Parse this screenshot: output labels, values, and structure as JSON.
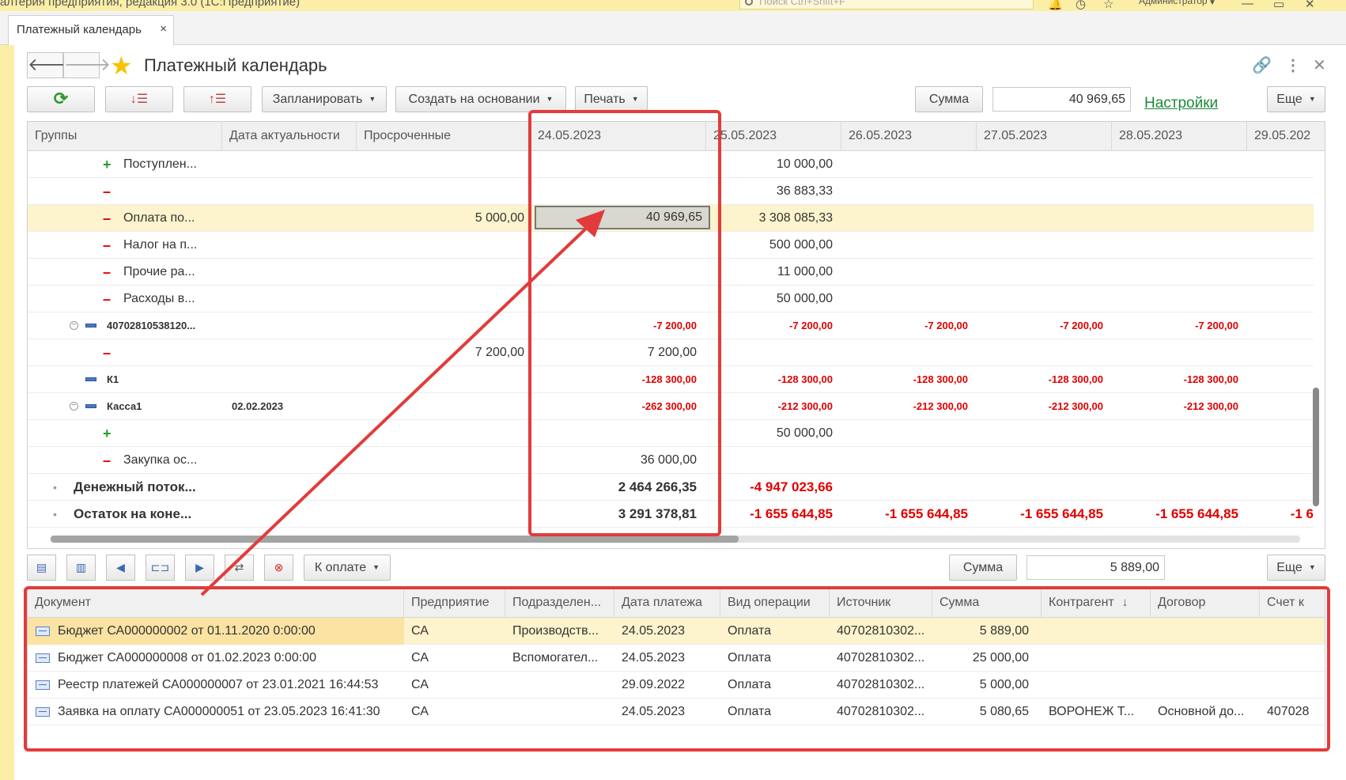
{
  "app": {
    "title": "алтерия предприятия, редакция 3.0  (1С:Предприятие)",
    "search_placeholder": "Поиск Ctrl+Shift+F",
    "user": "Администратор"
  },
  "tab": {
    "label": "Платежный календарь",
    "close": "×"
  },
  "page": {
    "title": "Платежный календарь"
  },
  "toolbar": {
    "plan": "Запланировать",
    "create_based": "Создать на основании",
    "print": "Печать",
    "sum_label": "Сумма",
    "sum_value": "40 969,65",
    "settings": "Настройки",
    "more": "Еще"
  },
  "grid": {
    "headers": [
      "Группы",
      "Дата актуальности",
      "Просроченные",
      "24.05.2023",
      "25.05.2023",
      "26.05.2023",
      "27.05.2023",
      "28.05.2023",
      "29.05.202"
    ],
    "rows": [
      {
        "mark": "+",
        "name": "Поступлен...",
        "actual": "",
        "overdue": "",
        "d24": "",
        "d25": "10 000,00",
        "d26": "",
        "d27": "",
        "d28": "",
        "d29": ""
      },
      {
        "mark": "–",
        "name": "",
        "actual": "",
        "overdue": "",
        "d24": "",
        "d25": "36 883,33",
        "d26": "",
        "d27": "",
        "d28": "",
        "d29": ""
      },
      {
        "mark": "–",
        "name": "Оплата по...",
        "actual": "",
        "overdue": "5 000,00",
        "d24": "40 969,65",
        "d25": "3 308 085,33",
        "d26": "",
        "d27": "",
        "d28": "",
        "d29": ""
      },
      {
        "mark": "–",
        "name": "Налог на п...",
        "actual": "",
        "overdue": "",
        "d24": "",
        "d25": "500 000,00",
        "d26": "",
        "d27": "",
        "d28": "",
        "d29": ""
      },
      {
        "mark": "–",
        "name": "Прочие ра...",
        "actual": "",
        "overdue": "",
        "d24": "",
        "d25": "11 000,00",
        "d26": "",
        "d27": "",
        "d28": "",
        "d29": ""
      },
      {
        "mark": "–",
        "name": "Расходы в...",
        "actual": "",
        "overdue": "",
        "d24": "",
        "d25": "50 000,00",
        "d26": "",
        "d27": "",
        "d28": "",
        "d29": ""
      },
      {
        "mark": "",
        "name": "40702810538120...",
        "actual": "",
        "overdue": "",
        "d24": "-7 200,00",
        "d25": "-7 200,00",
        "d26": "-7 200,00",
        "d27": "-7 200,00",
        "d28": "-7 200,00",
        "d29": ""
      },
      {
        "mark": "–",
        "name": "",
        "actual": "",
        "overdue": "7 200,00",
        "d24": "7 200,00",
        "d25": "",
        "d26": "",
        "d27": "",
        "d28": "",
        "d29": ""
      },
      {
        "mark": "",
        "name": "К1",
        "actual": "",
        "overdue": "",
        "d24": "-128 300,00",
        "d25": "-128 300,00",
        "d26": "-128 300,00",
        "d27": "-128 300,00",
        "d28": "-128 300,00",
        "d29": ""
      },
      {
        "mark": "",
        "name": "Касса1",
        "actual": "02.02.2023",
        "overdue": "",
        "d24": "-262 300,00",
        "d25": "-212 300,00",
        "d26": "-212 300,00",
        "d27": "-212 300,00",
        "d28": "-212 300,00",
        "d29": ""
      },
      {
        "mark": "+",
        "name": "",
        "actual": "",
        "overdue": "",
        "d24": "",
        "d25": "50 000,00",
        "d26": "",
        "d27": "",
        "d28": "",
        "d29": ""
      },
      {
        "mark": "–",
        "name": "Закупка ос...",
        "actual": "",
        "overdue": "",
        "d24": "36 000,00",
        "d25": "",
        "d26": "",
        "d27": "",
        "d28": "",
        "d29": ""
      },
      {
        "mark": "•",
        "name": "Денежный поток...",
        "actual": "",
        "overdue": "",
        "d24": "2 464 266,35",
        "d25": "-4 947 023,66",
        "d26": "",
        "d27": "",
        "d28": "",
        "d29": ""
      },
      {
        "mark": "•",
        "name": "Остаток на коне...",
        "actual": "",
        "overdue": "",
        "d24": "3 291 378,81",
        "d25": "-1 655 644,85",
        "d26": "-1 655 644,85",
        "d27": "-1 655 644,85",
        "d28": "-1 655 644,85",
        "d29": "-1 6"
      }
    ]
  },
  "bottom_toolbar": {
    "to_payment": "К оплате",
    "sum_label": "Сумма",
    "sum_value": "5 889,00",
    "more": "Еще"
  },
  "docs": {
    "headers": [
      "Документ",
      "Предприятие",
      "Подразделен...",
      "Дата платежа",
      "Вид операции",
      "Источник",
      "Сумма",
      "Контрагент",
      "Договор",
      "Счет к"
    ],
    "rows": [
      {
        "doc": "Бюджет СА000000002 от 01.11.2020 0:00:00",
        "org": "СА",
        "dept": "Производств...",
        "date": "24.05.2023",
        "op": "Оплата",
        "src": "40702810302...",
        "sum": "5 889,00",
        "agent": "",
        "contract": "",
        "acct": ""
      },
      {
        "doc": "Бюджет СА000000008 от 01.02.2023 0:00:00",
        "org": "СА",
        "dept": "Вспомогател...",
        "date": "24.05.2023",
        "op": "Оплата",
        "src": "40702810302...",
        "sum": "25 000,00",
        "agent": "",
        "contract": "",
        "acct": ""
      },
      {
        "doc": "Реестр платежей СА000000007 от 23.01.2021 16:44:53",
        "org": "СА",
        "dept": "",
        "date": "29.09.2022",
        "op": "Оплата",
        "src": "40702810302...",
        "sum": "5 000,00",
        "agent": "",
        "contract": "",
        "acct": ""
      },
      {
        "doc": "Заявка на оплату СА000000051 от 23.05.2023 16:41:30",
        "org": "СА",
        "dept": "",
        "date": "24.05.2023",
        "op": "Оплата",
        "src": "40702810302...",
        "sum": "5 080,65",
        "agent": "ВОРОНЕЖ Т...",
        "contract": "Основной до...",
        "acct": "407028"
      }
    ]
  },
  "colors": {
    "accent": "#fbeea6",
    "link": "#1a8a3b",
    "negative": "#e00000",
    "annotation": "#e23b3b"
  }
}
